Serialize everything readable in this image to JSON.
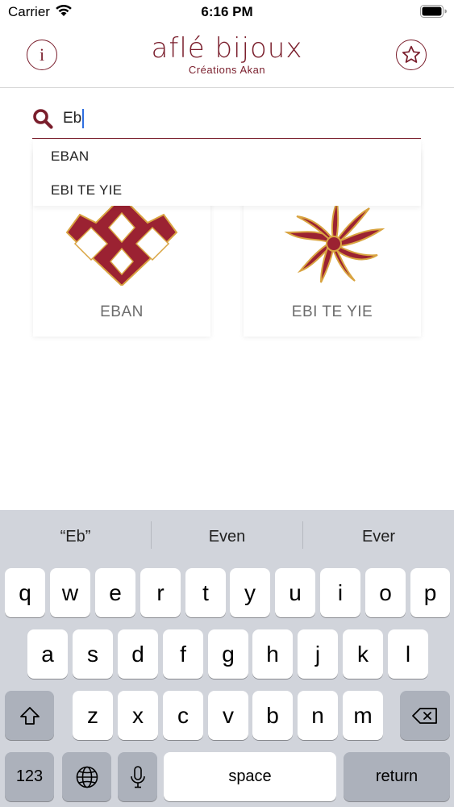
{
  "status_bar": {
    "carrier": "Carrier",
    "time": "6:16 PM"
  },
  "header": {
    "logo_title": "aflé bijoux",
    "logo_subtitle": "Créations Akan",
    "info_icon": "info-icon",
    "favorites_icon": "star-icon"
  },
  "search": {
    "value": "Eb",
    "icon": "search-icon"
  },
  "suggestions": [
    "EBAN",
    "EBI TE YIE"
  ],
  "cards": [
    {
      "label": "EBAN",
      "icon": "eban-symbol",
      "color": "#9b2232"
    },
    {
      "label": "EBI TE YIE",
      "icon": "ebi-te-yie-symbol",
      "color": "#9b2232"
    }
  ],
  "keyboard": {
    "predictions": [
      "“Eb”",
      "Even",
      "Ever"
    ],
    "row1": [
      "q",
      "w",
      "e",
      "r",
      "t",
      "y",
      "u",
      "i",
      "o",
      "p"
    ],
    "row2": [
      "a",
      "s",
      "d",
      "f",
      "g",
      "h",
      "j",
      "k",
      "l"
    ],
    "row3": [
      "z",
      "x",
      "c",
      "v",
      "b",
      "n",
      "m"
    ],
    "numbers_label": "123",
    "space_label": "space",
    "return_label": "return",
    "shift_icon": "shift-icon",
    "delete_icon": "delete-icon",
    "globe_icon": "globe-icon",
    "mic_icon": "microphone-icon"
  },
  "colors": {
    "brand": "#7a1e2c",
    "caret": "#2f6fe0",
    "keyboard_bg": "#d1d4db"
  }
}
